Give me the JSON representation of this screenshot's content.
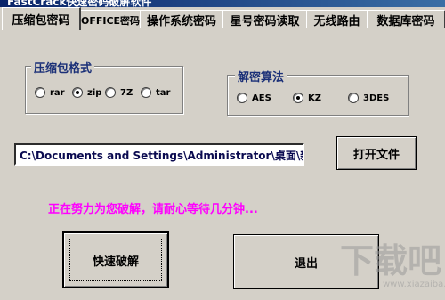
{
  "window": {
    "title": "FastCrack快速密码破解软件"
  },
  "tabs": [
    {
      "label": "压缩包密码",
      "active": true
    },
    {
      "label": "OFFICE密码",
      "active": false
    },
    {
      "label": "操作系统密码",
      "active": false
    },
    {
      "label": "星号密码读取",
      "active": false
    },
    {
      "label": "无线路由",
      "active": false
    },
    {
      "label": "数据库密码",
      "active": false
    }
  ],
  "format_group": {
    "title": "压缩包格式",
    "options": [
      {
        "label": "rar",
        "checked": false
      },
      {
        "label": "zip",
        "checked": true
      },
      {
        "label": "7Z",
        "checked": false
      },
      {
        "label": "tar",
        "checked": false
      }
    ]
  },
  "algo_group": {
    "title": "解密算法",
    "options": [
      {
        "label": "AES",
        "checked": false
      },
      {
        "label": "KZ",
        "checked": true
      },
      {
        "label": "3DES",
        "checked": false
      }
    ]
  },
  "path": {
    "value": "C:\\Documents and Settings\\Administrator\\桌面\\新建文件夹"
  },
  "buttons": {
    "open_file": "打开文件",
    "quick_crack": "快速破解",
    "exit": "退出"
  },
  "status": {
    "text": "正在努力为您破解，请耐心等待几分钟...",
    "color": "#ff00ff"
  },
  "watermark": {
    "text": "下载吧",
    "url": "www.xiazaiba.com"
  }
}
